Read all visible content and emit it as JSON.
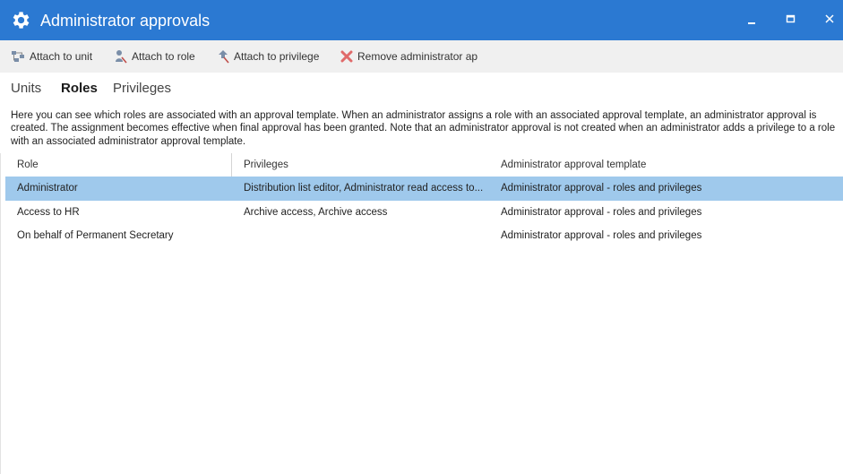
{
  "window": {
    "title": "Administrator approvals",
    "icon": "gear-icon",
    "controls": [
      "minimize-icon",
      "maximize-icon",
      "close-icon"
    ]
  },
  "toolbar": {
    "attach_unit": "Attach to unit",
    "attach_role": "Attach to role",
    "attach_privilege": "Attach to privilege",
    "remove": "Remove administrator ap"
  },
  "tabs": {
    "units": "Units",
    "roles": "Roles",
    "privileges": "Privileges",
    "active": "Roles"
  },
  "description": "Here you can see which roles are associated with an approval template. When an administrator assigns a role with an associated approval template, an administrator approval is created. The assignment becomes effective when final approval has been granted. Note that an administrator approval is not created when an administrator adds a privilege to a role with an associated administrator approval template.",
  "grid": {
    "headers": [
      "Role",
      "Privileges",
      "Administrator approval template"
    ],
    "rows": [
      [
        "Administrator",
        "Distribution list editor, Administrator read access to...",
        "Administrator approval - roles and privileges"
      ],
      [
        "Access to HR",
        "Archive access, Archive access",
        "Administrator approval - roles and privileges"
      ],
      [
        "On behalf of Permanent Secretary",
        "",
        "Administrator approval - roles and privileges"
      ]
    ],
    "selected_row": 0
  },
  "colors": {
    "titlebar": "#2b79d2",
    "toolbar": "#f0f0f0",
    "selection": "#9fc9ec",
    "remove_icon": "#e06a6a"
  }
}
